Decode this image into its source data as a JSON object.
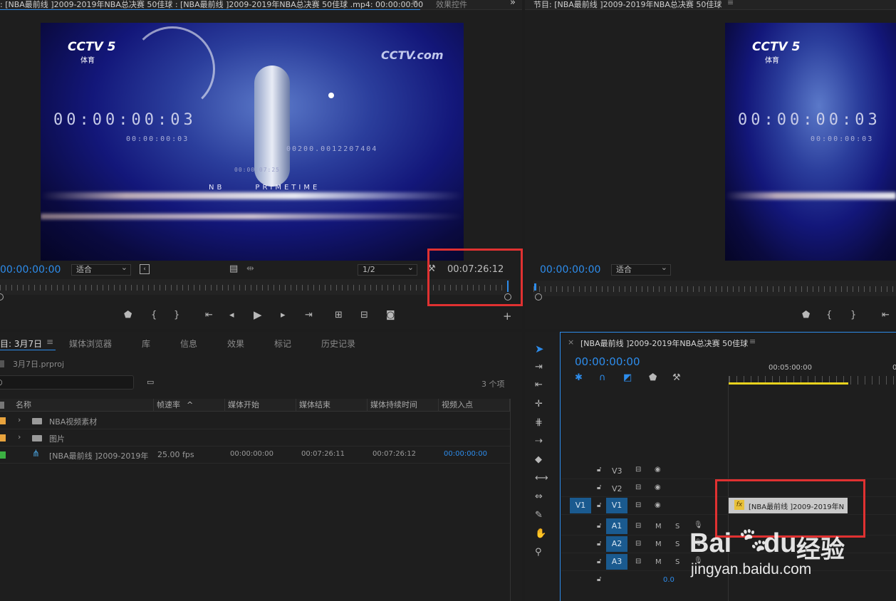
{
  "source_monitor": {
    "title": ": [NBA最前线 ]2009-2019年NBA总决赛 50佳球 : [NBA最前线 ]2009-2019年NBA总决赛 50佳球 .mp4: 00:00:00:00",
    "menu_icon": "≡",
    "effect_tab": "效果控件",
    "overflow_icon": "»",
    "timecode_left": "00:00:00:00",
    "fit_label": "适合",
    "resolution": "1/2",
    "duration": "00:07:26:12",
    "overlay": {
      "channel_logo": "CCTV 5",
      "channel_sub": "体育",
      "site_logo": "CCTV.com",
      "timecode_big": "00:00:00:03",
      "timecode_small": "00:00:00:03",
      "serial": "00200.0012207404",
      "small_tc": "00:00:07:25",
      "banner": "NB      PRIMETIME"
    }
  },
  "program_monitor": {
    "title": "节目: [NBA最前线 ]2009-2019年NBA总决赛 50佳球",
    "menu_icon": "≡",
    "timecode": "00:00:00:00",
    "fit_label": "适合"
  },
  "project_panel": {
    "tabs": [
      "目: 3月7日",
      "媒体浏览器",
      "库",
      "信息",
      "效果",
      "标记",
      "历史记录"
    ],
    "menu_icon": "≡",
    "project_file": "3月7日.prproj",
    "search_placeholder": "",
    "item_count": "3 个项",
    "columns": [
      "名称",
      "帧速率",
      "媒体开始",
      "媒体结束",
      "媒体持续时间",
      "视频入点"
    ],
    "sort_icon": "^",
    "rows": [
      {
        "name": "NBA视频素材",
        "type": "folder",
        "color": "#e8a33d",
        "fps": "",
        "start": "",
        "end": "",
        "duration": "",
        "in": ""
      },
      {
        "name": "图片",
        "type": "folder",
        "color": "#e8a33d",
        "fps": "",
        "start": "",
        "end": "",
        "duration": "",
        "in": ""
      },
      {
        "name": "[NBA最前线 ]2009-2019年",
        "type": "sequence",
        "color": "#3cb043",
        "fps": "25.00 fps",
        "start": "00:00:00:00",
        "end": "00:07:26:11",
        "duration": "00:07:26:12",
        "in": "00:00:00:00"
      }
    ]
  },
  "timeline": {
    "close_icon": "×",
    "title": "[NBA最前线 ]2009-2019年NBA总决赛 50佳球",
    "menu_icon": "≡",
    "timecode": "00:00:00:00",
    "ruler_label": "00:05:00:00",
    "ruler_label2": "0",
    "tracks": [
      {
        "name": "V3",
        "type": "video"
      },
      {
        "name": "V2",
        "type": "video"
      },
      {
        "name": "V1",
        "type": "video",
        "source": "V1"
      },
      {
        "name": "A1",
        "type": "audio"
      },
      {
        "name": "A2",
        "type": "audio"
      },
      {
        "name": "A3",
        "type": "audio"
      }
    ],
    "mute": "M",
    "solo": "S",
    "master_value": "0.0",
    "clip_label": "[NBA最前线 ]2009-2019年N",
    "clip_fx": "fx"
  },
  "watermark": {
    "brand": "Bai",
    "brand2": "du",
    "brand_cn": "经验",
    "url": "jingyan.baidu.com"
  },
  "colors": {
    "accent": "#2d8ceb",
    "highlight_box": "#e03131",
    "track_target": "#1a5a8f"
  }
}
